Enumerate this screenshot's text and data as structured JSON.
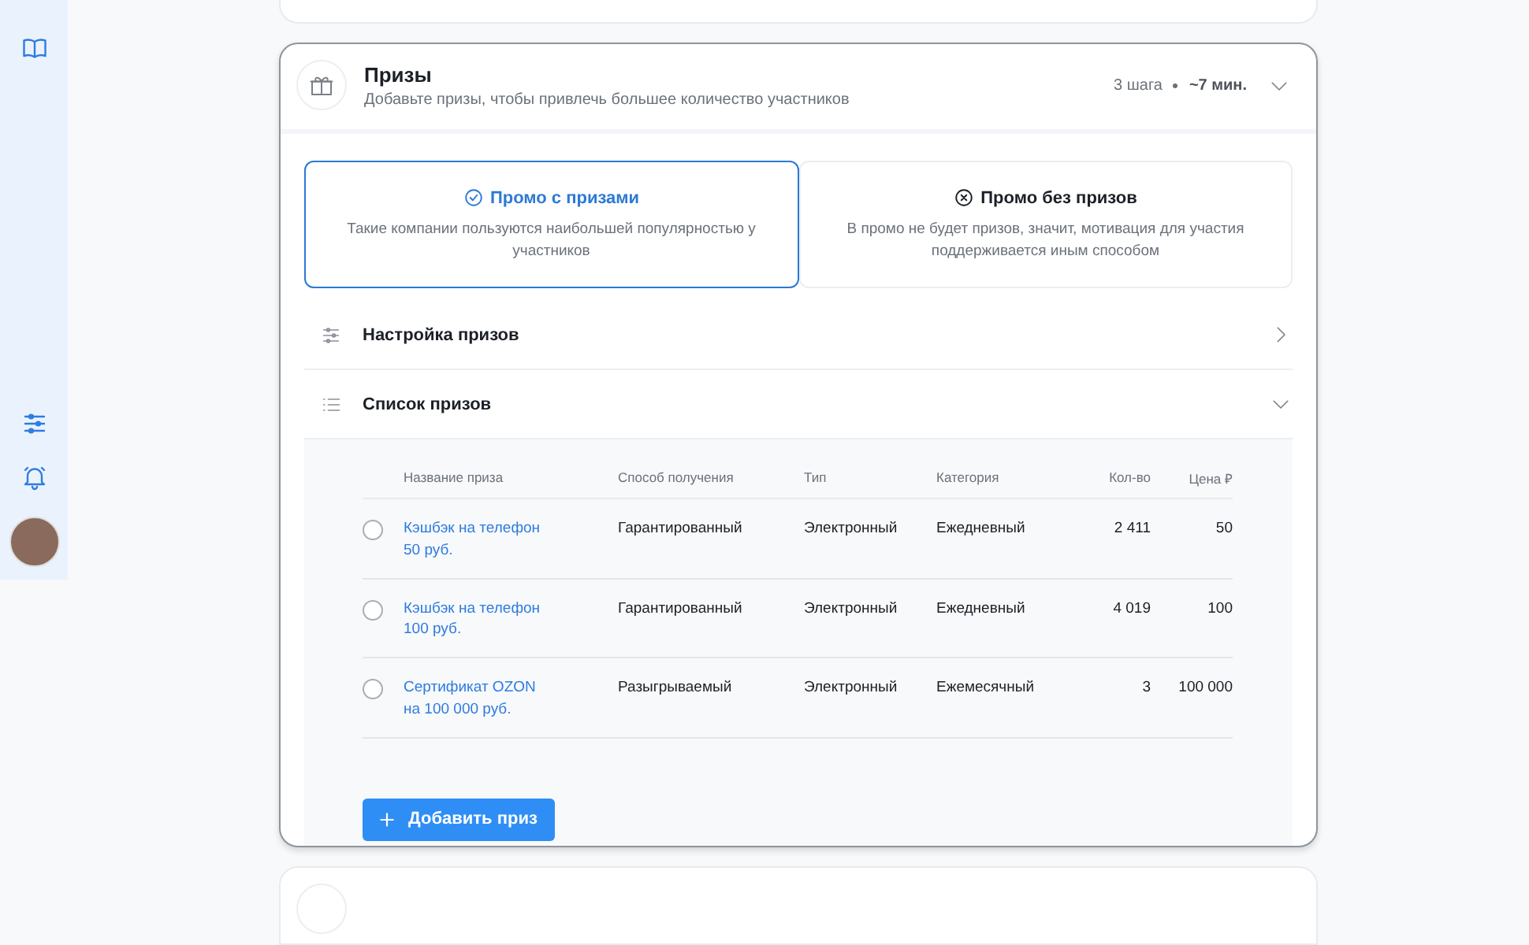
{
  "sidebar": {
    "items": [
      {
        "kind": "book"
      },
      {
        "kind": "sliders"
      },
      {
        "kind": "bell"
      }
    ],
    "avatar": true
  },
  "card": {
    "title": "Призы",
    "subtitle": "Добавьте призы, чтобы привлечь большее количество участников",
    "steps": "3 шага",
    "duration": "~7 мин.",
    "expanded": true,
    "options": [
      {
        "kind": "check",
        "title": "Промо с призами",
        "description": "Такие компании пользуются наибольшей популярностью у участников",
        "selected": true
      },
      {
        "kind": "cross",
        "title": "Промо без призов",
        "description": "В промо не будет призов, значит, мотивация для участия поддерживается иным способом",
        "selected": false
      }
    ],
    "sections": [
      {
        "kind": "sliders",
        "title": "Настройка призов",
        "expanded": false
      },
      {
        "kind": "list",
        "title": "Список призов",
        "expanded": true
      }
    ],
    "table": {
      "columns": [
        "Название приза",
        "Способ получения",
        "Тип",
        "Категория",
        "Кол-во",
        "Цена ₽"
      ],
      "rows": [
        {
          "selected": false,
          "cells": [
            "Кэшбэк на телефон 50 руб.",
            "Гарантированный",
            "Электронный",
            "Ежедневный",
            "2 411",
            "50"
          ]
        },
        {
          "selected": false,
          "cells": [
            "Кэшбэк на телефон 100 руб.",
            "Гарантированный",
            "Электронный",
            "Ежедневный",
            "4 019",
            "100"
          ]
        },
        {
          "selected": false,
          "cells": [
            "Сертификат OZON на 100 000 руб.",
            "Разыгрываемый",
            "Электронный",
            "Ежемесячный",
            "3",
            "100 000"
          ]
        }
      ]
    },
    "add_button": "Добавить приз"
  }
}
